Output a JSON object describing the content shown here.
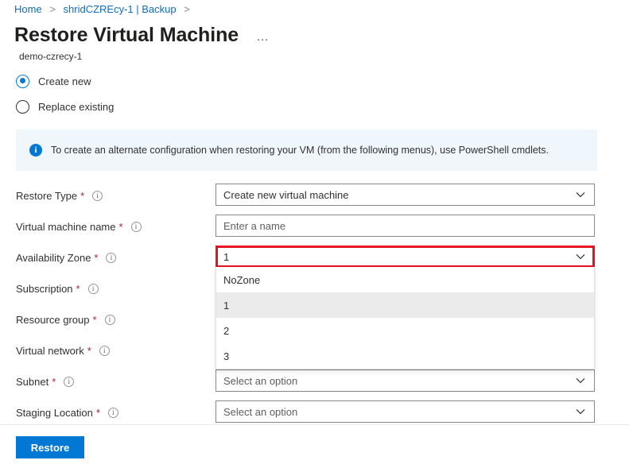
{
  "breadcrumb": {
    "items": [
      {
        "label": "Home",
        "separator": ">"
      },
      {
        "label": "shridCZREcy-1 | Backup",
        "separator": ">"
      }
    ]
  },
  "header": {
    "title": "Restore Virtual Machine",
    "ellipsis": "…",
    "subtitle": "demo-czrecy-1"
  },
  "restore_mode": {
    "options": [
      {
        "label": "Create new",
        "selected": true
      },
      {
        "label": "Replace existing",
        "selected": false
      }
    ]
  },
  "info_banner": {
    "icon": "info-icon",
    "text": "To create an alternate configuration when restoring your VM (from the following menus), use PowerShell cmdlets.",
    "background_color": "#eff6fc",
    "icon_color": "#0078d4"
  },
  "form": {
    "info_glyph": "i",
    "required_marker": "*",
    "fields": [
      {
        "label": "Restore Type",
        "required": true,
        "type": "dropdown",
        "value": "Create new virtual machine",
        "is_placeholder": false
      },
      {
        "label": "Virtual machine name",
        "required": true,
        "type": "textbox",
        "value": "Enter a name",
        "is_placeholder": true
      },
      {
        "label": "Availability Zone",
        "required": true,
        "type": "dropdown",
        "value": "1",
        "is_placeholder": false,
        "highlighted": true,
        "expanded": true
      },
      {
        "label": "Subscription",
        "required": true,
        "type": "dropdown",
        "value": "",
        "is_placeholder": true,
        "hidden_by_popup": true
      },
      {
        "label": "Resource group",
        "required": true,
        "type": "dropdown",
        "value": "",
        "is_placeholder": true,
        "hidden_by_popup": true
      },
      {
        "label": "Virtual network",
        "required": true,
        "type": "dropdown",
        "value": "",
        "is_placeholder": true,
        "hidden_by_popup": true
      },
      {
        "label": "Subnet",
        "required": true,
        "type": "dropdown",
        "value": "Select an option",
        "is_placeholder": true
      },
      {
        "label": "Staging Location",
        "required": true,
        "type": "dropdown",
        "value": "Select an option",
        "is_placeholder": true
      }
    ]
  },
  "availability_zone_dropdown": {
    "options": [
      {
        "label": "NoZone",
        "selected": false
      },
      {
        "label": "1",
        "selected": true
      },
      {
        "label": "2",
        "selected": false
      },
      {
        "label": "3",
        "selected": false
      }
    ],
    "highlight_color": "#e81123",
    "selected_row_color": "#ebebeb"
  },
  "footer": {
    "restore_label": "Restore",
    "button_color": "#0078d4"
  }
}
